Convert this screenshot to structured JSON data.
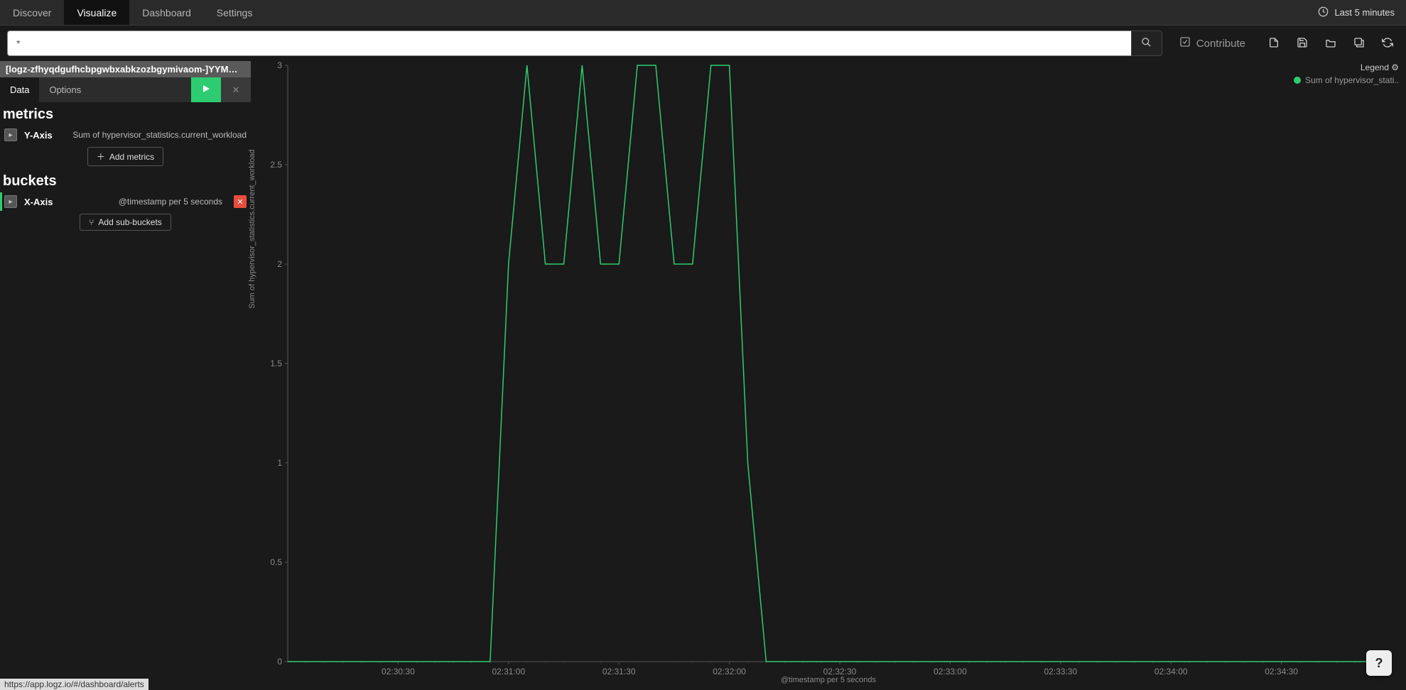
{
  "topnav": {
    "tabs": [
      "Discover",
      "Visualize",
      "Dashboard",
      "Settings"
    ],
    "active": 1,
    "time_label": "Last 5 minutes"
  },
  "toolbar": {
    "search_value": "*",
    "contribute_label": "Contribute"
  },
  "sidebar": {
    "index_pattern": "[logz-zfhyqdgufhcbpgwbxabkzozbgymivaom-]YYMMDD",
    "tabs": {
      "data": "Data",
      "options": "Options"
    },
    "metrics_title": "metrics",
    "metrics": [
      {
        "axis": "Y-Axis",
        "desc": "Sum of hypervisor_statistics.current_workload"
      }
    ],
    "add_metrics_label": "Add metrics",
    "buckets_title": "buckets",
    "buckets": [
      {
        "axis": "X-Axis",
        "desc": "@timestamp per 5 seconds"
      }
    ],
    "add_buckets_label": "Add sub-buckets"
  },
  "legend": {
    "title": "Legend",
    "series": "Sum of hypervisor_stati.."
  },
  "chart_data": {
    "type": "line",
    "title": "",
    "xlabel": "@timestamp per 5 seconds",
    "ylabel": "Sum of hypervisor_statistics.current_workload",
    "ylim": [
      0,
      3
    ],
    "y_ticks": [
      0,
      0.5,
      1,
      1.5,
      2,
      2.5,
      3
    ],
    "x_ticks": [
      "02:30:30",
      "02:31:00",
      "02:31:30",
      "02:32:00",
      "02:32:30",
      "02:33:00",
      "02:33:30",
      "02:34:00",
      "02:34:30"
    ],
    "x_domain_sec": [
      0,
      300
    ],
    "x_tick_positions_sec": [
      30,
      60,
      90,
      120,
      150,
      180,
      210,
      240,
      270
    ],
    "series": [
      {
        "name": "Sum of hypervisor_statistics.current_workload",
        "color": "#2ecc71",
        "x_sec": [
          0,
          5,
          10,
          15,
          20,
          25,
          30,
          35,
          40,
          45,
          50,
          55,
          60,
          65,
          70,
          75,
          80,
          85,
          90,
          95,
          100,
          105,
          110,
          115,
          120,
          125,
          130,
          135,
          140,
          145,
          150,
          155,
          160,
          165,
          170,
          175,
          180,
          185,
          190,
          195,
          200,
          205,
          210,
          215,
          220,
          225,
          230,
          235,
          240,
          245,
          250,
          255,
          260,
          265,
          270,
          275,
          280,
          285,
          290,
          295,
          300
        ],
        "y": [
          0,
          0,
          0,
          0,
          0,
          0,
          0,
          0,
          0,
          0,
          0,
          0,
          2,
          3,
          2,
          2,
          3,
          2,
          2,
          3,
          3,
          2,
          2,
          3,
          3,
          1,
          0,
          0,
          0,
          0,
          0,
          0,
          0,
          0,
          0,
          0,
          0,
          0,
          0,
          0,
          0,
          0,
          0,
          0,
          0,
          0,
          0,
          0,
          0,
          0,
          0,
          0,
          0,
          0,
          0,
          0,
          0,
          0,
          0,
          0,
          0
        ]
      }
    ]
  },
  "status_bar": "https://app.logz.io/#/dashboard/alerts",
  "help_label": "?"
}
